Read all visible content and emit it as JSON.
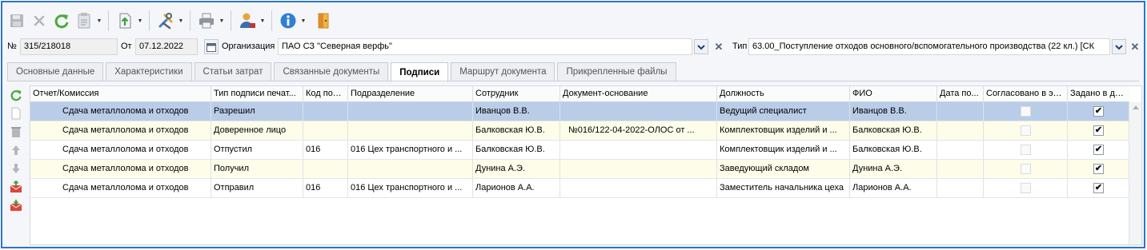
{
  "document": {
    "number_label": "№",
    "number_value": "315/218018",
    "date_label": "От",
    "date_value": "07.12.2022",
    "org_label": "Организация",
    "org_value": "ПАО СЗ \"Северная верфь\"",
    "type_label": "Тип",
    "type_value": "63.00_Поступление отходов основного/вспомогательного производства (22 кл.) [СК"
  },
  "tabs": [
    {
      "label": "Основные данные",
      "active": false
    },
    {
      "label": "Характеристики",
      "active": false
    },
    {
      "label": "Статьи затрат",
      "active": false
    },
    {
      "label": "Связанные документы",
      "active": false
    },
    {
      "label": "Подписи",
      "active": true
    },
    {
      "label": "Маршрут документа",
      "active": false
    },
    {
      "label": "Прикрепленные файлы",
      "active": false
    }
  ],
  "toolbar_icons": [
    "save-icon",
    "cancel-icon",
    "refresh-icon",
    "copy-icon",
    "export-icon",
    "tools-icon",
    "print-icon",
    "user-icon",
    "info-icon",
    "exit-door-icon"
  ],
  "side_icons": [
    "refresh-icon",
    "new-icon",
    "delete-icon",
    "move-up-icon",
    "move-down-icon",
    "send-mail-icon",
    "receive-mail-icon"
  ],
  "grid": {
    "columns": [
      "Отчет/Комиссия",
      "Тип подписи печат...",
      "Код под...",
      "Подразделение",
      "Сотрудник",
      "Документ-основание",
      "Должность",
      "ФИО",
      "Дата по...",
      "Согласовано в эл...",
      "Задано в до..."
    ],
    "rows": [
      {
        "commission": "Сдача металлолома и отходов",
        "sign_type": "Разрешил",
        "code": "",
        "department": "",
        "employee": "Иванцов В.В.",
        "basis": "",
        "position": "Ведущий специалист",
        "fio": "Иванцов В.В.",
        "date": "",
        "agreed": false,
        "set_in_doc": true,
        "style": "selected"
      },
      {
        "commission": "Сдача металлолома и отходов",
        "sign_type": "Доверенное лицо",
        "code": "",
        "department": "",
        "employee": "Балковская Ю.В.",
        "basis": "№016/122-04-2022-ОЛОС от ...",
        "position": "Комплектовщик изделий и ...",
        "fio": "Балковская Ю.В.",
        "date": "",
        "agreed": false,
        "set_in_doc": true,
        "style": "yellow"
      },
      {
        "commission": "Сдача металлолома и отходов",
        "sign_type": "Отпустил",
        "code": "016",
        "department": "016 Цех транспортного и ...",
        "employee": "Балковская Ю.В.",
        "basis": "",
        "position": "Комплектовщик изделий и ...",
        "fio": "Балковская Ю.В.",
        "date": "",
        "agreed": false,
        "set_in_doc": true,
        "style": "white"
      },
      {
        "commission": "Сдача металлолома и отходов",
        "sign_type": "Получил",
        "code": "",
        "department": "",
        "employee": "Дунина А.Э.",
        "basis": "",
        "position": "Заведующий складом",
        "fio": "Дунина А.Э.",
        "date": "",
        "agreed": false,
        "set_in_doc": true,
        "style": "yellow"
      },
      {
        "commission": "Сдача металлолома и отходов",
        "sign_type": "Отправил",
        "code": "016",
        "department": "016 Цех транспортного и ...",
        "employee": "Ларионов А.А.",
        "basis": "",
        "position": "Заместитель начальника цеха",
        "fio": "Ларионов А.А.",
        "date": "",
        "agreed": false,
        "set_in_doc": true,
        "style": "white"
      }
    ]
  },
  "check_mark": "✔",
  "colors": {
    "frame": "#2e75c8",
    "selected_row": "#b9cde9",
    "alt_row": "#fdfde9"
  }
}
